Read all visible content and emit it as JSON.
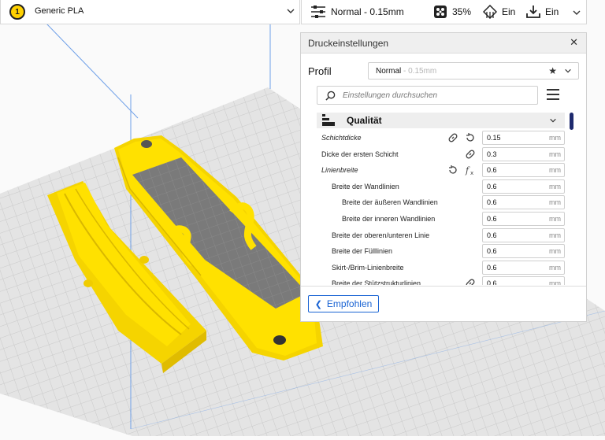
{
  "material": {
    "extruder_number": "1",
    "label": "Generic PLA"
  },
  "print_settings_bar": {
    "profile_label": "Normal - 0.15mm",
    "infill_label": "35%",
    "support_label": "Ein",
    "adhesion_label": "Ein"
  },
  "panel": {
    "title": "Druckeinstellungen",
    "profile_label": "Profil",
    "profile_name": "Normal",
    "profile_sub": "- 0.15mm",
    "search_placeholder": "Einstellungen durchsuchen",
    "category": "Qualität",
    "settings": [
      {
        "label": "Schichtdicke",
        "value": "0.15",
        "unit": "mm"
      },
      {
        "label": "Dicke der ersten Schicht",
        "value": "0.3",
        "unit": "mm"
      },
      {
        "label": "Linienbreite",
        "value": "0.6",
        "unit": "mm"
      },
      {
        "label": "Breite der Wandlinien",
        "value": "0.6",
        "unit": "mm"
      },
      {
        "label": "Breite der äußeren Wandlinien",
        "value": "0.6",
        "unit": "mm"
      },
      {
        "label": "Breite der inneren Wandlinien",
        "value": "0.6",
        "unit": "mm"
      },
      {
        "label": "Breite der oberen/unteren Linie",
        "value": "0.6",
        "unit": "mm"
      },
      {
        "label": "Breite der Fülllinien",
        "value": "0.6",
        "unit": "mm"
      },
      {
        "label": "Skirt-/Brim-Linienbreite",
        "value": "0.6",
        "unit": "mm"
      },
      {
        "label": "Breite der Stützstrukturlinien",
        "value": "0.6",
        "unit": "mm"
      }
    ],
    "recommended_button": "Empfohlen"
  },
  "colors": {
    "accent": "#1963d3",
    "model": "#ffde00",
    "plate": "#dedede",
    "grid": "#c9c9c9"
  }
}
